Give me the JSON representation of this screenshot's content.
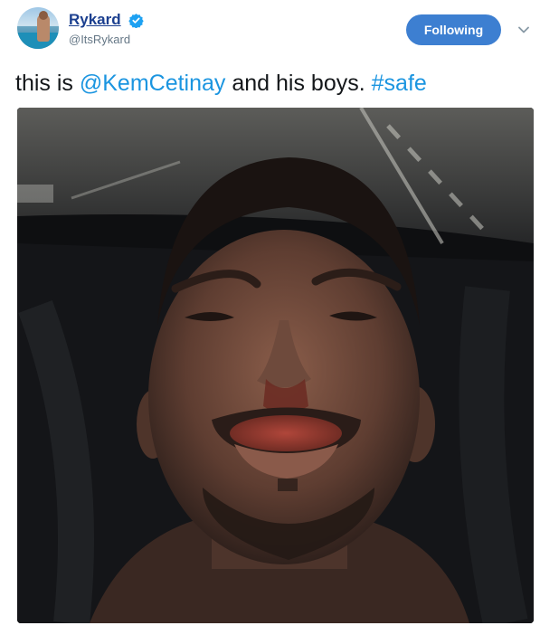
{
  "tweet": {
    "author": {
      "display_name": "Rykard",
      "handle": "@ItsRykard",
      "verified": true
    },
    "follow_button_label": "Following",
    "text": {
      "prefix": "this is ",
      "mention": "@KemCetinay",
      "middle": " and his boys. ",
      "hashtag": "#safe"
    }
  },
  "colors": {
    "accent": "#3d7fd1",
    "link": "#1b95e0",
    "name": "#1b3f8f",
    "handle": "#657786"
  },
  "icons": {
    "verified": "verified-badge-icon",
    "menu": "chevron-down-icon"
  }
}
